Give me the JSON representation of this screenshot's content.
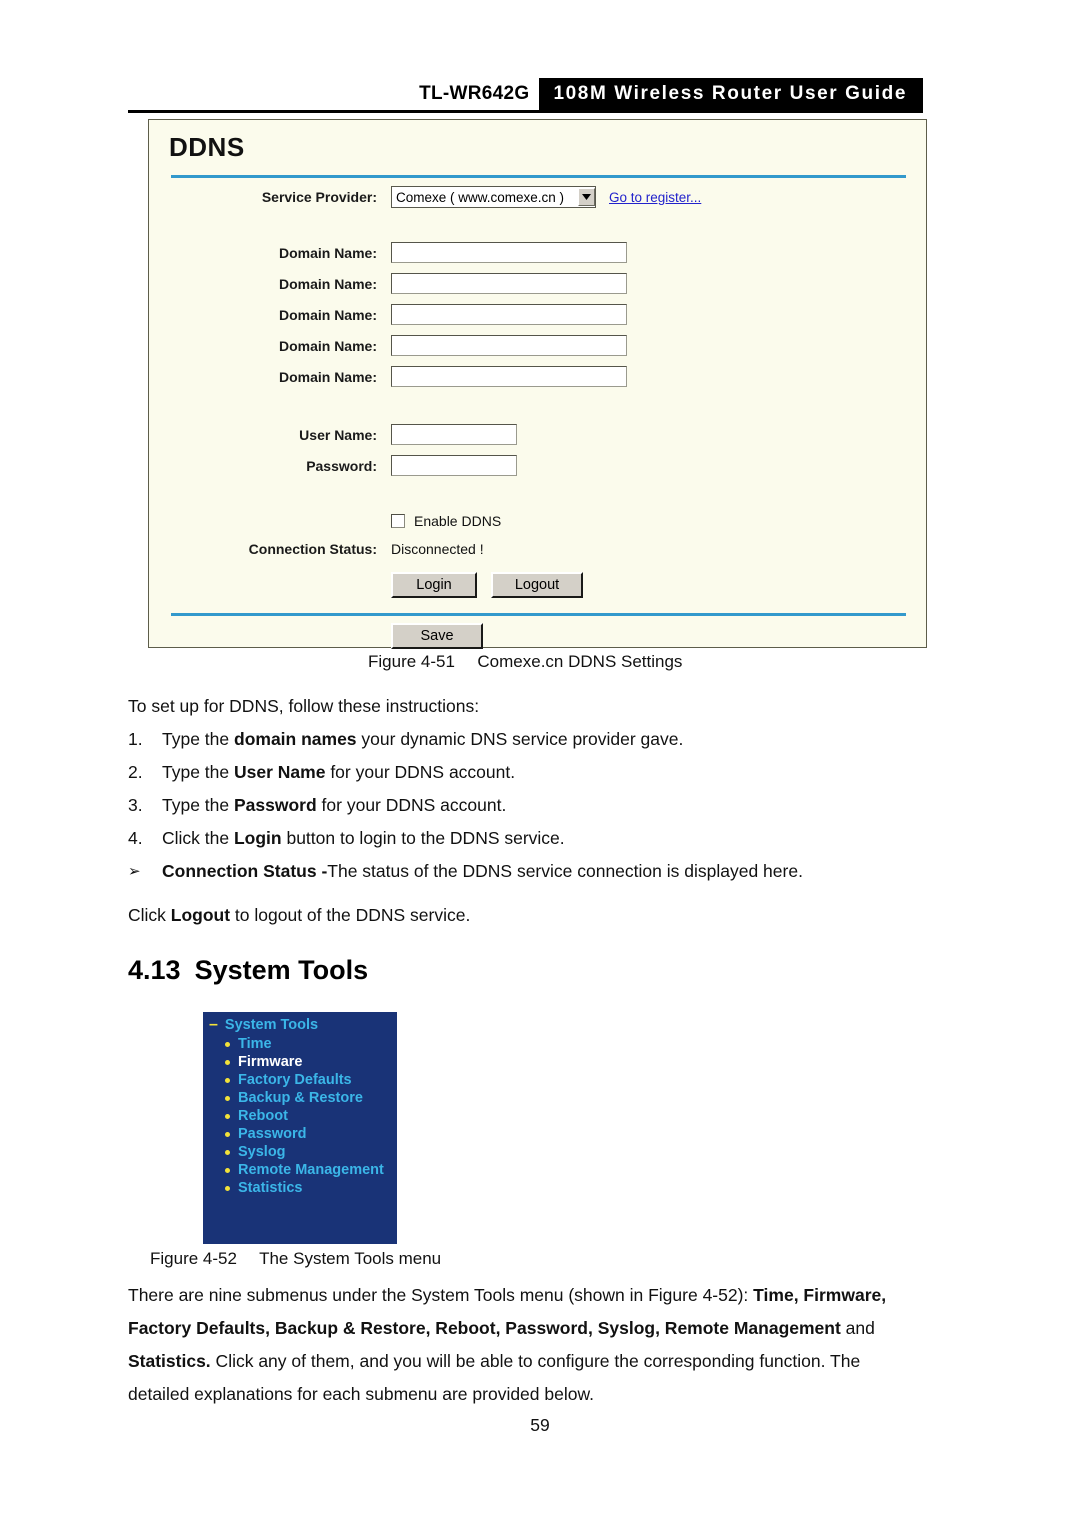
{
  "header": {
    "model": "TL-WR642G",
    "banner_title": "108M Wireless Router User Guide"
  },
  "ddns_panel": {
    "title": "DDNS",
    "service_provider_label": "Service Provider:",
    "service_provider_value": "Comexe ( www.comexe.cn )",
    "register_link": "Go to register...",
    "domain_name_label_1": "Domain Name:",
    "domain_name_label_2": "Domain Name:",
    "domain_name_label_3": "Domain Name:",
    "domain_name_label_4": "Domain Name:",
    "domain_name_label_5": "Domain Name:",
    "domain_name_value_1": "",
    "domain_name_value_2": "",
    "domain_name_value_3": "",
    "domain_name_value_4": "",
    "domain_name_value_5": "",
    "user_name_label": "User Name:",
    "user_name_value": "",
    "password_label": "Password:",
    "password_value": "",
    "enable_ddns_label": "Enable DDNS",
    "enable_ddns_checked": false,
    "connection_status_label": "Connection Status:",
    "connection_status_value": "Disconnected !",
    "login_button": "Login",
    "logout_button": "Logout",
    "save_button": "Save",
    "colors": {
      "panel_background": "#fbfbec",
      "divider_blue": "#3399cc",
      "link_blue": "#2222cc",
      "button_face": "#d4d0c8"
    }
  },
  "figure_51": {
    "number": "Figure 4-51",
    "caption": "Comexe.cn DDNS Settings"
  },
  "instructions": {
    "intro": "To set up for DDNS, follow these instructions:",
    "items": [
      {
        "marker": "1.",
        "pre": "Type the ",
        "bold": "domain names",
        "post": " your dynamic DNS service provider gave."
      },
      {
        "marker": "2.",
        "pre": "Type the ",
        "bold": "User Name",
        "post": " for your DDNS account."
      },
      {
        "marker": "3.",
        "pre": "Type the ",
        "bold": "Password",
        "post": " for your DDNS account."
      },
      {
        "marker": "4.",
        "pre": "Click the ",
        "bold": "Login",
        "post": " button to login to the DDNS service."
      },
      {
        "marker": "➢",
        "pre": "",
        "bold": "Connection Status -",
        "post": "The status of the DDNS service connection is displayed here."
      }
    ],
    "closing_pre": "Click ",
    "closing_bold": "Logout",
    "closing_post": " to logout of the DDNS service."
  },
  "section": {
    "number": "4.13",
    "title": "System Tools"
  },
  "system_tools_menu": {
    "collapse_icon": "–",
    "header": "System Tools",
    "items": [
      {
        "label": "Time",
        "selected": false
      },
      {
        "label": "Firmware",
        "selected": true
      },
      {
        "label": "Factory Defaults",
        "selected": false
      },
      {
        "label": "Backup & Restore",
        "selected": false
      },
      {
        "label": "Reboot",
        "selected": false
      },
      {
        "label": "Password",
        "selected": false
      },
      {
        "label": "Syslog",
        "selected": false
      },
      {
        "label": "Remote Management",
        "selected": false
      },
      {
        "label": "Statistics",
        "selected": false
      }
    ],
    "colors": {
      "background": "#193377",
      "link": "#3bb6e8",
      "selected": "#ffffff",
      "bullet": "#f2e23a"
    }
  },
  "figure_52": {
    "number": "Figure 4-52",
    "caption": "The System Tools menu"
  },
  "closing_paragraph": {
    "line1_pre": "There are nine submenus under the System Tools menu (shown in ",
    "line1_fig": "Figure 4-52",
    "line1_mid": "): ",
    "line1_bold": "Time, Firmware,",
    "line2_bold": "Factory Defaults, Backup & Restore, Reboot, Password, Syslog, Remote Management",
    "line2_post": " and",
    "line3_bold": "Statistics.",
    "line3_post": " Click any of them, and you will be able to configure the corresponding function. The",
    "line4": "detailed explanations for each submenu are provided below."
  },
  "page_number": "59"
}
